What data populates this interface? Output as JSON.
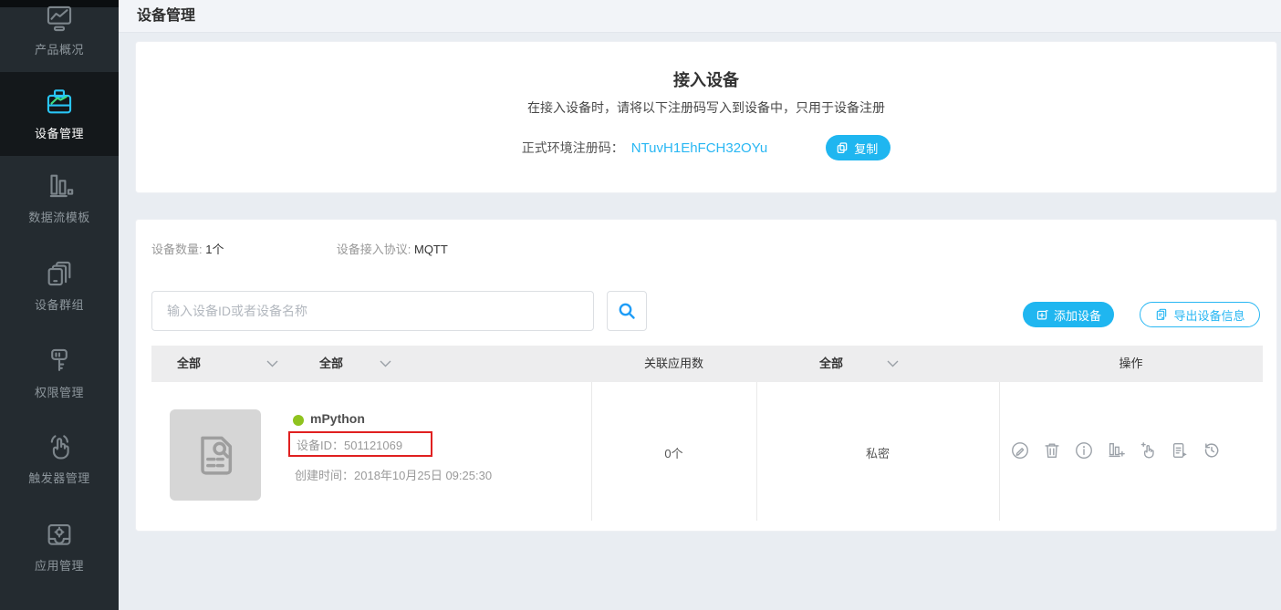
{
  "colors": {
    "accent": "#29b7f3",
    "button_fill": "#1fb6f0",
    "status_green": "#8fc31f",
    "annotation_red": "#e02020",
    "sidebar_bg": "#242b30",
    "sidebar_active_bg": "#14181b"
  },
  "header": {
    "title": "设备管理"
  },
  "sidebar": {
    "items": [
      {
        "label": "产品概况"
      },
      {
        "label": "设备管理"
      },
      {
        "label": "数据流模板"
      },
      {
        "label": "设备群组"
      },
      {
        "label": "权限管理"
      },
      {
        "label": "触发器管理"
      },
      {
        "label": "应用管理"
      }
    ]
  },
  "access_card": {
    "title": "接入设备",
    "subtitle": "在接入设备时，请将以下注册码写入到设备中，只用于设备注册",
    "reg_label": "正式环境注册码：",
    "reg_code": "NTuvH1EhFCH32OYu",
    "copy_label": "复制"
  },
  "device_card": {
    "count_label": "设备数量:",
    "count_value": "1个",
    "protocol_label": "设备接入协议:",
    "protocol_value": "MQTT",
    "search_placeholder": "输入设备ID或者设备名称",
    "add_button": "添加设备",
    "export_button": "导出设备信息",
    "table": {
      "filter1": "全部",
      "filter2": "全部",
      "filter3": "全部",
      "col_apps": "关联应用数",
      "col_actions": "操作",
      "row": {
        "name": "mPython",
        "device_id": "设备ID：501121069",
        "created": "创建时间：2018年10月25日 09:25:30",
        "apps_count": "0个",
        "privacy": "私密"
      }
    }
  }
}
